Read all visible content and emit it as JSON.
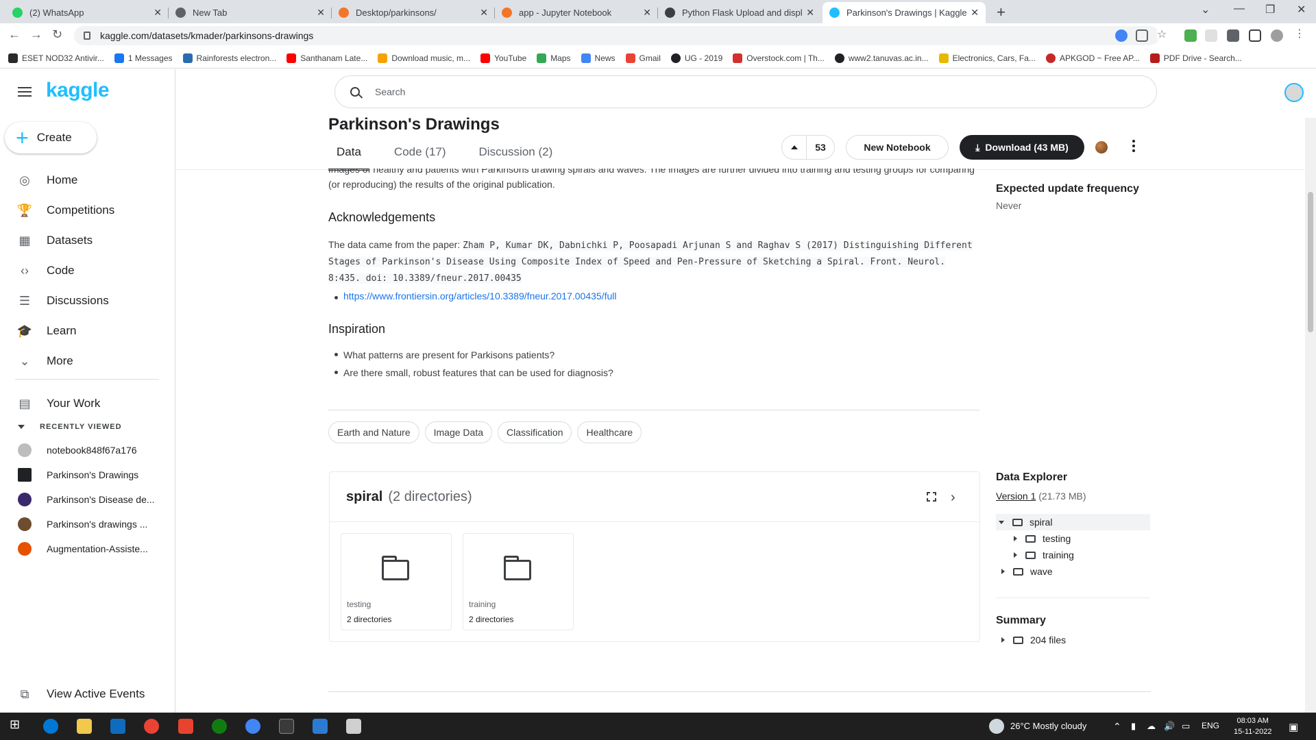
{
  "browser": {
    "tabs": [
      {
        "label": "(2) WhatsApp",
        "color": "#25d366"
      },
      {
        "label": "New Tab",
        "color": "#5f6368"
      },
      {
        "label": "Desktop/parkinsons/",
        "color": "#f37626"
      },
      {
        "label": "app - Jupyter Notebook",
        "color": "#f37626"
      },
      {
        "label": "Python Flask Upload and display",
        "color": "#3c4043"
      },
      {
        "label": "Parkinson's Drawings | Kaggle",
        "color": "#20beff"
      }
    ],
    "url": "kaggle.com/datasets/kmader/parkinsons-drawings",
    "bookmarks": [
      {
        "label": "ESET NOD32 Antivir...",
        "color": "#2a2a2a"
      },
      {
        "label": "1 Messages",
        "color": "#1877f2"
      },
      {
        "label": "Rainforests electron...",
        "color": "#2b6cb0"
      },
      {
        "label": "Santhanam Late...",
        "color": "#ff0000"
      },
      {
        "label": "Download music, m...",
        "color": "#f4a300"
      },
      {
        "label": "YouTube",
        "color": "#ff0000"
      },
      {
        "label": "Maps",
        "color": "#34a853"
      },
      {
        "label": "News",
        "color": "#4285f4"
      },
      {
        "label": "Gmail",
        "color": "#ea4335"
      },
      {
        "label": "UG - 2019",
        "color": "#202124"
      },
      {
        "label": "Overstock.com | Th...",
        "color": "#d32f2f"
      },
      {
        "label": "www2.tanuvas.ac.in...",
        "color": "#202124"
      },
      {
        "label": "Electronics, Cars, Fa...",
        "color": "#e6b800"
      },
      {
        "label": "APKGOD ~ Free AP...",
        "color": "#c62828"
      },
      {
        "label": "PDF Drive - Search...",
        "color": "#b71c1c"
      }
    ]
  },
  "sidebar": {
    "logo": "kaggle",
    "create_label": "Create",
    "nav": [
      {
        "label": "Home",
        "icon": "◎"
      },
      {
        "label": "Competitions",
        "icon": "🏆"
      },
      {
        "label": "Datasets",
        "icon": "▦"
      },
      {
        "label": "Code",
        "icon": "‹›"
      },
      {
        "label": "Discussions",
        "icon": "☰"
      },
      {
        "label": "Learn",
        "icon": "🎓"
      },
      {
        "label": "More",
        "icon": "⌄"
      }
    ],
    "your_work": "Your Work",
    "recently_viewed_label": "RECENTLY VIEWED",
    "recent": [
      {
        "label": "notebook848f67a176",
        "color": "#bdbdbd"
      },
      {
        "label": "Parkinson's Drawings",
        "color": "#202124"
      },
      {
        "label": "Parkinson's Disease de...",
        "color": "#3a2a6a"
      },
      {
        "label": "Parkinson's drawings ...",
        "color": "#6d4c2f"
      },
      {
        "label": "Augmentation-Assiste...",
        "color": "#e65100"
      }
    ],
    "active_events": "View Active Events"
  },
  "header": {
    "search_placeholder": "Search",
    "title": "Parkinson's Drawings",
    "tabs": [
      "Data",
      "Code (17)",
      "Discussion (2)"
    ],
    "votes": "53",
    "new_notebook": "New Notebook",
    "download": "Download (43 MB)"
  },
  "content": {
    "intro": "Images of healthy and patients with Parkinsons drawing spirals and waves. The images are further divided into training and testing groups for comparing (or reproducing) the results of the original publication.",
    "ack_heading": "Acknowledgements",
    "ack_lead": "The data came from the paper: ",
    "ack_citation": "Zham P, Kumar DK, Dabnichki P, Poosapadi Arjunan S and Raghav S (2017) Distinguishing Different Stages of Parkinson's Disease Using Composite Index of Speed and Pen-Pressure of Sketching a Spiral. Front. Neurol. 8:435. doi: 10.3389/fneur.2017.00435",
    "ack_link": "https://www.frontiersin.org/articles/10.3389/fneur.2017.00435/full",
    "insp_heading": "Inspiration",
    "insp_items": [
      "What patterns are present for Parkisons patients?",
      "Are there small, robust features that can be used for diagnosis?"
    ],
    "tags": [
      "Earth and Nature",
      "Image Data",
      "Classification",
      "Healthcare"
    ]
  },
  "explorer": {
    "name": "spiral",
    "sub": "(2 directories)",
    "folders": [
      {
        "name": "testing",
        "count": "2 directories"
      },
      {
        "name": "training",
        "count": "2 directories"
      }
    ]
  },
  "right": {
    "freq_heading": "Expected update frequency",
    "freq_value": "Never",
    "de_heading": "Data Explorer",
    "version": "Version 1",
    "version_size": " (21.73 MB)",
    "tree": [
      {
        "label": "spiral",
        "expanded": true,
        "level": 0,
        "selected": true
      },
      {
        "label": "testing",
        "expanded": false,
        "level": 1,
        "selected": false
      },
      {
        "label": "training",
        "expanded": false,
        "level": 1,
        "selected": false
      },
      {
        "label": "wave",
        "expanded": false,
        "level": 0,
        "selected": false
      }
    ],
    "summary_heading": "Summary",
    "summary_files": "204 files"
  },
  "taskbar": {
    "weather": "26°C  Mostly cloudy",
    "lang": "ENG",
    "time": "08:03 AM",
    "date": "15-11-2022"
  }
}
